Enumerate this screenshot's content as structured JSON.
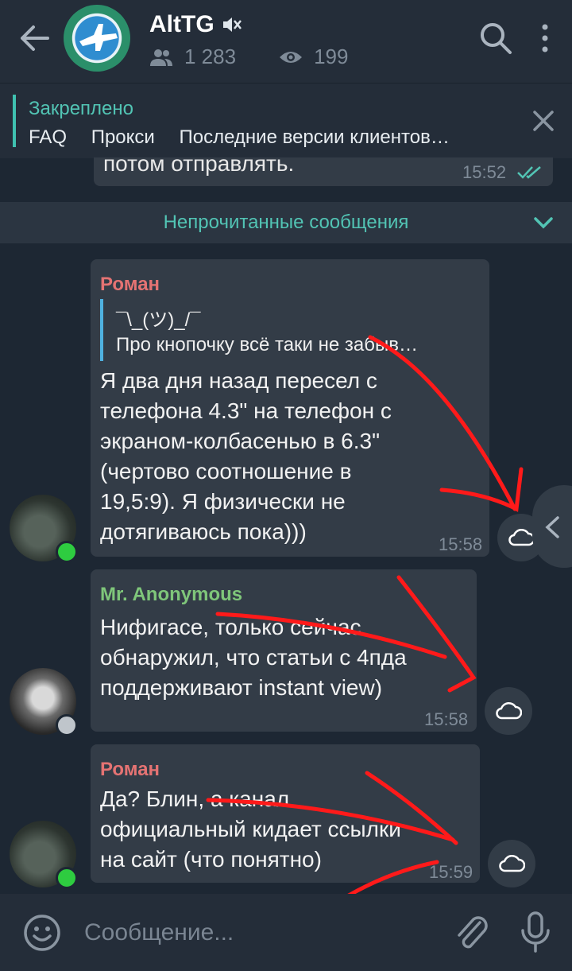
{
  "header": {
    "title": "AltTG",
    "members": "1 283",
    "views": "199",
    "icons": [
      "back-arrow-icon",
      "channel-avatar",
      "mute-icon",
      "people-icon",
      "eye-icon",
      "search-icon",
      "more-icon"
    ]
  },
  "pinned": {
    "title": "Закреплено",
    "links": [
      "FAQ",
      "Прокси",
      "Последние версии клиентов…"
    ]
  },
  "previous": {
    "text": "потом отправлять.",
    "time": "15:52"
  },
  "unread_label": "Непрочитанные сообщения",
  "messages": [
    {
      "sender": "Роман",
      "sender_color": "#e57373",
      "quote_author": "¯\\_(ツ)_/¯",
      "quote_text": "Про кнопочку всё таки не забыв…",
      "lines": [
        "Я два дня назад пересел с",
        "телефона 4.3\" на телефон с",
        "экраном-колбасенью в 6.3\"",
        "(чертово соотношение в",
        "19,5:9). Я физически не",
        "дотягиваюсь пока)))"
      ],
      "time": "15:58",
      "status": "online"
    },
    {
      "sender": "Mr. Anonymous",
      "sender_color": "#7fc67a",
      "lines": [
        "Нифигасе, только сейчас",
        "обнаружил, что статьи с 4пда",
        "поддерживают instant view)"
      ],
      "time": "15:58",
      "status": "offline"
    },
    {
      "sender": "Роман",
      "sender_color": "#e57373",
      "lines": [
        "Да? Блин, а канал",
        "официальный кидает ссылки",
        "на сайт (что понятно)"
      ],
      "time": "15:59",
      "status": "online"
    }
  ],
  "colors": {
    "accent": "#52c4b4",
    "online": "#2ecc40",
    "annotation": "#ff1a1a"
  },
  "composer": {
    "placeholder": "Сообщение..."
  }
}
